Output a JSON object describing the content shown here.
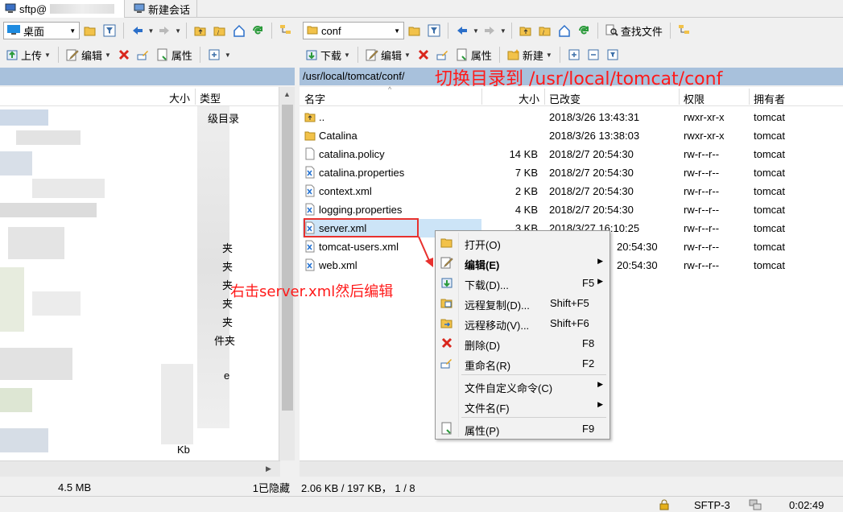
{
  "tabs": {
    "session_label": "sftp@",
    "new_session_label": "新建会话"
  },
  "left_toolbar": {
    "location_label": "桌面",
    "upload_label": "上传",
    "edit_label": "编辑",
    "properties_label": "属性"
  },
  "right_toolbar": {
    "location_label": "conf",
    "find_files_label": "查找文件",
    "download_label": "下载",
    "edit_label": "编辑",
    "properties_label": "属性",
    "new_label": "新建"
  },
  "left_panel": {
    "header": {
      "size": "大小",
      "type": "类型"
    },
    "visible_fragments": [
      "级目录",
      "夹",
      "夹",
      "夹",
      "夹",
      "夹",
      "件夹",
      "e",
      "Kb"
    ],
    "status": "1已隐藏",
    "status_fragment": "4.5 MB"
  },
  "right_panel": {
    "path": "/usr/local/tomcat/conf/",
    "columns": {
      "name": "名字",
      "size": "大小",
      "modified": "已改变",
      "permissions": "权限",
      "owner": "拥有者"
    },
    "files": [
      {
        "name": "..",
        "size": "",
        "modified": "2018/3/26 13:43:31",
        "permissions": "rwxr-xr-x",
        "owner": "tomcat",
        "kind": "folder-up"
      },
      {
        "name": "Catalina",
        "size": "",
        "modified": "2018/3/26 13:38:03",
        "permissions": "rwxr-xr-x",
        "owner": "tomcat",
        "kind": "folder"
      },
      {
        "name": "catalina.policy",
        "size": "14 KB",
        "modified": "2018/2/7 20:54:30",
        "permissions": "rw-r--r--",
        "owner": "tomcat",
        "kind": "file"
      },
      {
        "name": "catalina.properties",
        "size": "7 KB",
        "modified": "2018/2/7 20:54:30",
        "permissions": "rw-r--r--",
        "owner": "tomcat",
        "kind": "code"
      },
      {
        "name": "context.xml",
        "size": "2 KB",
        "modified": "2018/2/7 20:54:30",
        "permissions": "rw-r--r--",
        "owner": "tomcat",
        "kind": "code"
      },
      {
        "name": "logging.properties",
        "size": "4 KB",
        "modified": "2018/2/7 20:54:30",
        "permissions": "rw-r--r--",
        "owner": "tomcat",
        "kind": "code"
      },
      {
        "name": "server.xml",
        "size": "3 KB",
        "modified": "2018/3/27 16:10:25",
        "permissions": "rw-r--r--",
        "owner": "tomcat",
        "kind": "code"
      },
      {
        "name": "tomcat-users.xml",
        "size": "",
        "modified": "20:54:30",
        "permissions": "rw-r--r--",
        "owner": "tomcat",
        "kind": "code"
      },
      {
        "name": "web.xml",
        "size": "",
        "modified": "20:54:30",
        "permissions": "rw-r--r--",
        "owner": "tomcat",
        "kind": "code"
      }
    ],
    "status": "2.06 KB / 197 KB， 1 / 8"
  },
  "context_menu": {
    "items": [
      {
        "label": "打开(O)",
        "shortcut": "",
        "submenu": false,
        "icon": "open-folder-icon"
      },
      {
        "label": "编辑(E)",
        "shortcut": "",
        "submenu": true,
        "icon": "edit-icon",
        "bold": true
      },
      {
        "label": "下载(D)...",
        "shortcut": "F5",
        "submenu": true,
        "icon": "download-icon"
      },
      {
        "label": "远程复制(D)...",
        "shortcut": "Shift+F5",
        "submenu": false,
        "icon": "remote-copy-icon"
      },
      {
        "label": "远程移动(V)...",
        "shortcut": "Shift+F6",
        "submenu": false,
        "icon": "remote-move-icon"
      },
      {
        "label": "删除(D)",
        "shortcut": "F8",
        "submenu": false,
        "icon": "delete-icon"
      },
      {
        "label": "重命名(R)",
        "shortcut": "F2",
        "submenu": false,
        "icon": "rename-icon"
      },
      {
        "label": "文件自定义命令(C)",
        "shortcut": "",
        "submenu": true,
        "icon": ""
      },
      {
        "label": "文件名(F)",
        "shortcut": "",
        "submenu": true,
        "icon": ""
      },
      {
        "label": "属性(P)",
        "shortcut": "F9",
        "submenu": false,
        "icon": "properties-icon"
      }
    ]
  },
  "annotations": {
    "top": "切换目录到 /usr/local/tomcat/conf",
    "middle": "右击server.xml然后编辑"
  },
  "statusbar": {
    "protocol": "SFTP-3",
    "elapsed": "0:02:49"
  },
  "colors": {
    "path_bar": "#a8c1dc",
    "selection": "#cce4f7",
    "annotation": "#ff1a1a"
  }
}
